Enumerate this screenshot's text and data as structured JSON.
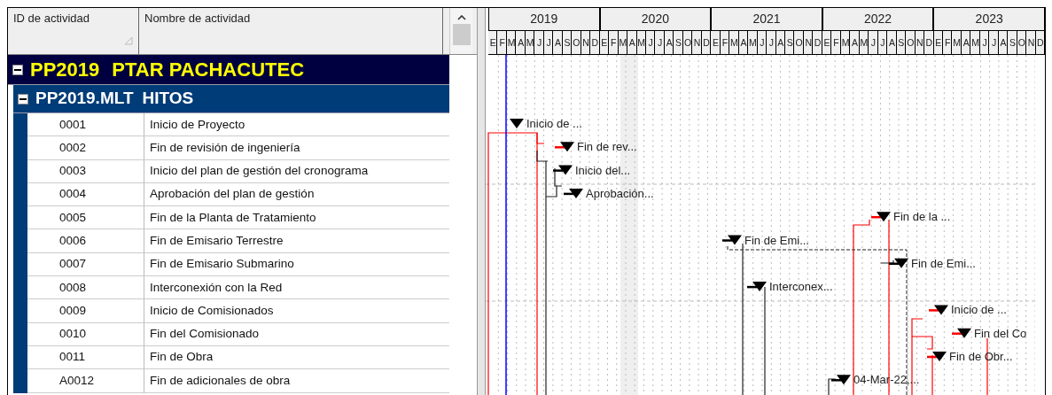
{
  "table": {
    "columns": [
      {
        "label": "ID de actividad",
        "sorted": true
      },
      {
        "label": "Nombre de actividad",
        "sorted": false
      }
    ]
  },
  "timescale": [
    {
      "year": "2019",
      "months": [
        "E",
        "F",
        "M",
        "A",
        "M",
        "J",
        "J",
        "A",
        "S",
        "O",
        "N",
        "D"
      ]
    },
    {
      "year": "2020",
      "months": [
        "E",
        "F",
        "M",
        "A",
        "M",
        "J",
        "J",
        "A",
        "S",
        "O",
        "N",
        "D"
      ]
    },
    {
      "year": "2021",
      "months": [
        "E",
        "F",
        "M",
        "A",
        "M",
        "J",
        "J",
        "A",
        "S",
        "O",
        "N",
        "D"
      ]
    },
    {
      "year": "2022",
      "months": [
        "E",
        "F",
        "M",
        "A",
        "M",
        "J",
        "J",
        "A",
        "S",
        "O",
        "N",
        "D"
      ]
    },
    {
      "year": "2023",
      "months": [
        "E",
        "F",
        "M",
        "A",
        "M",
        "J",
        "J",
        "A",
        "S",
        "O",
        "N",
        "D"
      ]
    }
  ],
  "project": {
    "code": "PP2019",
    "name": "PTAR PACHACUTEC",
    "expanded": true,
    "wbs": {
      "code": "PP2019.MLT",
      "name": "HITOS",
      "expanded": true,
      "activities": [
        {
          "id": "0001",
          "name": "Inicio de Proyecto",
          "bar_label": "Inicio de ...",
          "critical": false
        },
        {
          "id": "0002",
          "name": "Fin de revisión de ingeniería",
          "bar_label": "Fin de rev...",
          "critical": true
        },
        {
          "id": "0003",
          "name": "Inicio del plan de gestión del cronograma",
          "bar_label": "Inicio del...",
          "critical": false
        },
        {
          "id": "0004",
          "name": "Aprobación del plan de gestión",
          "bar_label": "Aprobación...",
          "critical": false
        },
        {
          "id": "0005",
          "name": "Fin de la Planta de Tratamiento",
          "bar_label": "Fin de la ...",
          "critical": true
        },
        {
          "id": "0006",
          "name": "Fin de Emisario Terrestre",
          "bar_label": "Fin de Emi...",
          "critical": false
        },
        {
          "id": "0007",
          "name": "Fin de Emisario Submarino",
          "bar_label": "Fin de Emi...",
          "critical": false
        },
        {
          "id": "0008",
          "name": "Interconexión con la Red",
          "bar_label": "Interconex...",
          "critical": false
        },
        {
          "id": "0009",
          "name": "Inicio de Comisionados",
          "bar_label": "Inicio de ...",
          "critical": true
        },
        {
          "id": "0010",
          "name": "Fin del Comisionado",
          "bar_label": "Fin del Co",
          "critical": true
        },
        {
          "id": "0011",
          "name": "Fin de Obra",
          "bar_label": "Fin de Obr...",
          "critical": true
        },
        {
          "id": "A0012",
          "name": "Fin de adicionales de obra",
          "bar_label": "04-Mar-22,...",
          "critical": false
        }
      ]
    }
  }
}
